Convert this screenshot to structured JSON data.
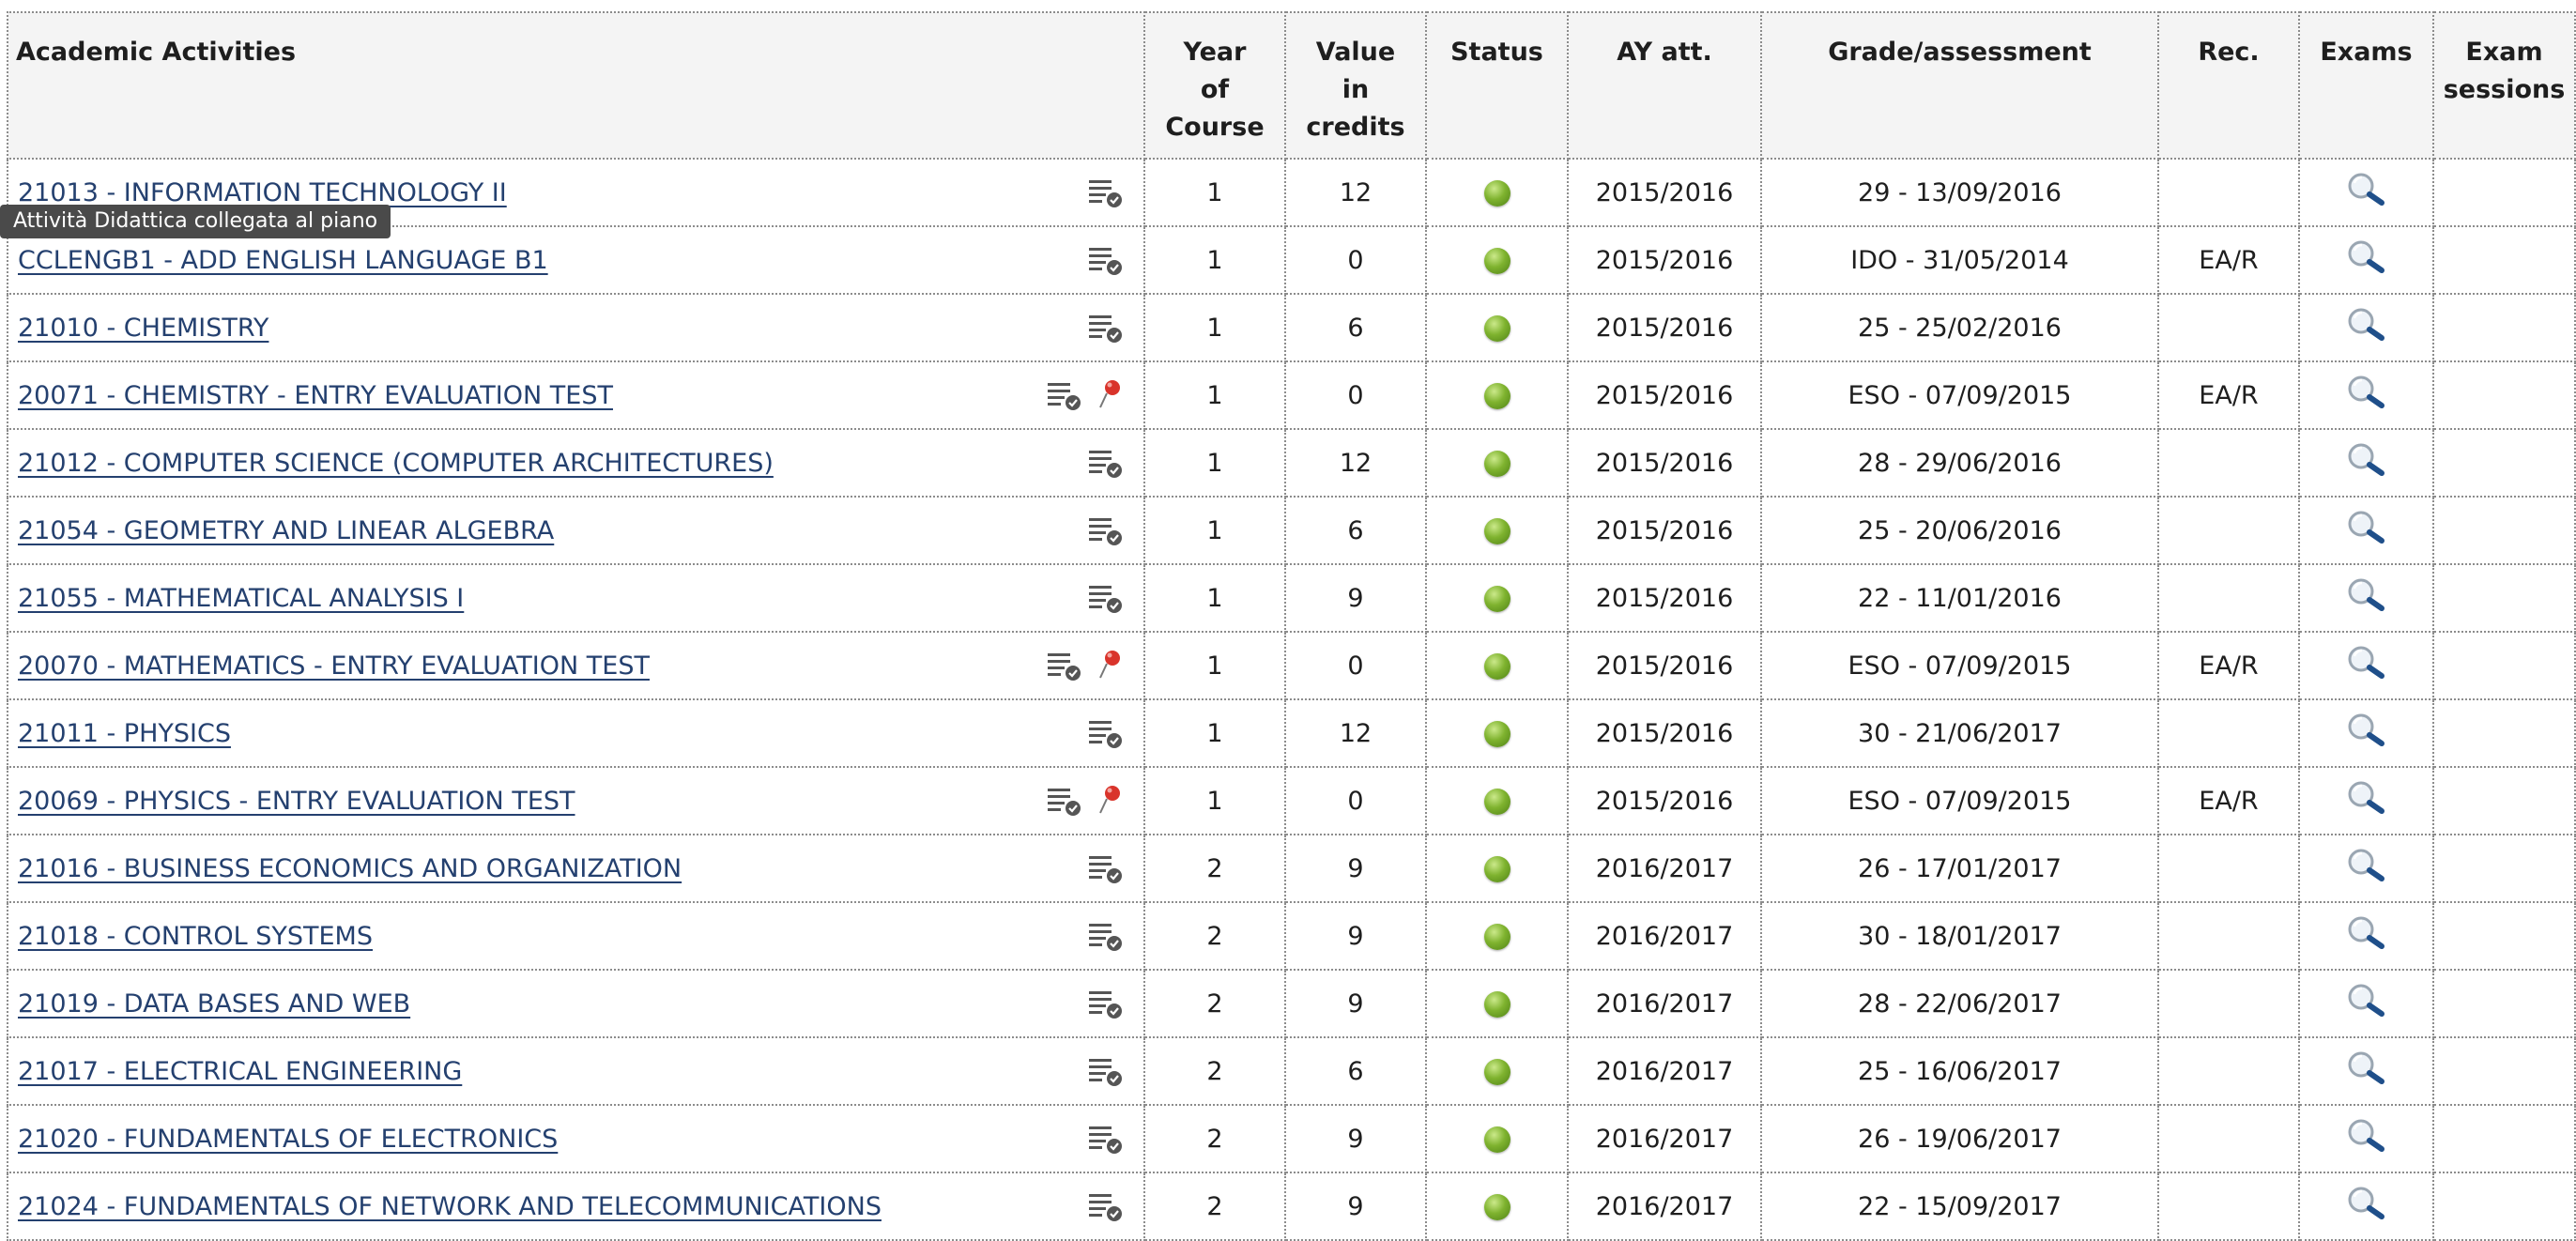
{
  "table": {
    "headers": {
      "activity": "Academic Activities",
      "year_line1": "Year",
      "year_line2": "of",
      "year_line3": "Course",
      "credits_line1": "Value",
      "credits_line2": "in",
      "credits_line3": "credits",
      "status": "Status",
      "ay": "AY att.",
      "grade": "Grade/assessment",
      "rec": "Rec.",
      "exams": "Exams",
      "sessions_line1": "Exam",
      "sessions_line2": "sessions"
    },
    "rows": [
      {
        "activity": "21013 - INFORMATION TECHNOLOGY II",
        "year": "1",
        "credits": "12",
        "ay": "2015/2016",
        "grade": "29 - 13/09/2016",
        "rec": ""
      },
      {
        "activity": "CCLENGB1 - ADD ENGLISH LANGUAGE B1",
        "year": "1",
        "credits": "0",
        "ay": "2015/2016",
        "grade": "IDO - 31/05/2014",
        "rec": "EA/R"
      },
      {
        "activity": "21010 - CHEMISTRY",
        "year": "1",
        "credits": "6",
        "ay": "2015/2016",
        "grade": "25 - 25/02/2016",
        "rec": ""
      },
      {
        "activity": "20071 - CHEMISTRY - ENTRY EVALUATION TEST",
        "year": "1",
        "credits": "0",
        "ay": "2015/2016",
        "grade": "ESO - 07/09/2015",
        "rec": "EA/R"
      },
      {
        "activity": "21012 - COMPUTER SCIENCE (COMPUTER ARCHITECTURES)",
        "year": "1",
        "credits": "12",
        "ay": "2015/2016",
        "grade": "28 - 29/06/2016",
        "rec": ""
      },
      {
        "activity": "21054 - GEOMETRY AND LINEAR ALGEBRA",
        "year": "1",
        "credits": "6",
        "ay": "2015/2016",
        "grade": "25 - 20/06/2016",
        "rec": ""
      },
      {
        "activity": "21055 - MATHEMATICAL ANALYSIS I",
        "year": "1",
        "credits": "9",
        "ay": "2015/2016",
        "grade": "22 - 11/01/2016",
        "rec": ""
      },
      {
        "activity": "20070 - MATHEMATICS - ENTRY EVALUATION TEST",
        "year": "1",
        "credits": "0",
        "ay": "2015/2016",
        "grade": "ESO - 07/09/2015",
        "rec": "EA/R"
      },
      {
        "activity": "21011 - PHYSICS",
        "year": "1",
        "credits": "12",
        "ay": "2015/2016",
        "grade": "30 - 21/06/2017",
        "rec": ""
      },
      {
        "activity": "20069 - PHYSICS - ENTRY EVALUATION TEST",
        "year": "1",
        "credits": "0",
        "ay": "2015/2016",
        "grade": "ESO - 07/09/2015",
        "rec": "EA/R"
      },
      {
        "activity": "21016 - BUSINESS ECONOMICS AND ORGANIZATION",
        "year": "2",
        "credits": "9",
        "ay": "2016/2017",
        "grade": "26 - 17/01/2017",
        "rec": ""
      },
      {
        "activity": "21018 - CONTROL SYSTEMS",
        "year": "2",
        "credits": "9",
        "ay": "2016/2017",
        "grade": "30 - 18/01/2017",
        "rec": ""
      },
      {
        "activity": "21019 - DATA BASES AND WEB",
        "year": "2",
        "credits": "9",
        "ay": "2016/2017",
        "grade": "28 - 22/06/2017",
        "rec": ""
      },
      {
        "activity": "21017 - ELECTRICAL ENGINEERING",
        "year": "2",
        "credits": "6",
        "ay": "2016/2017",
        "grade": "25 - 16/06/2017",
        "rec": ""
      },
      {
        "activity": "21020 - FUNDAMENTALS OF ELECTRONICS",
        "year": "2",
        "credits": "9",
        "ay": "2016/2017",
        "grade": "26 - 19/06/2017",
        "rec": ""
      },
      {
        "activity": "21024 - FUNDAMENTALS OF NETWORK AND TELECOMMUNICATIONS",
        "year": "2",
        "credits": "9",
        "ay": "2016/2017",
        "grade": "22 - 15/09/2017",
        "rec": ""
      }
    ]
  },
  "tooltip": {
    "text": "Attività Didattica collegata al piano"
  },
  "colors": {
    "link": "#24406f",
    "status_passed": "#6aa82a",
    "header_bg": "#f4f4f4",
    "pin": "#d9342b"
  }
}
